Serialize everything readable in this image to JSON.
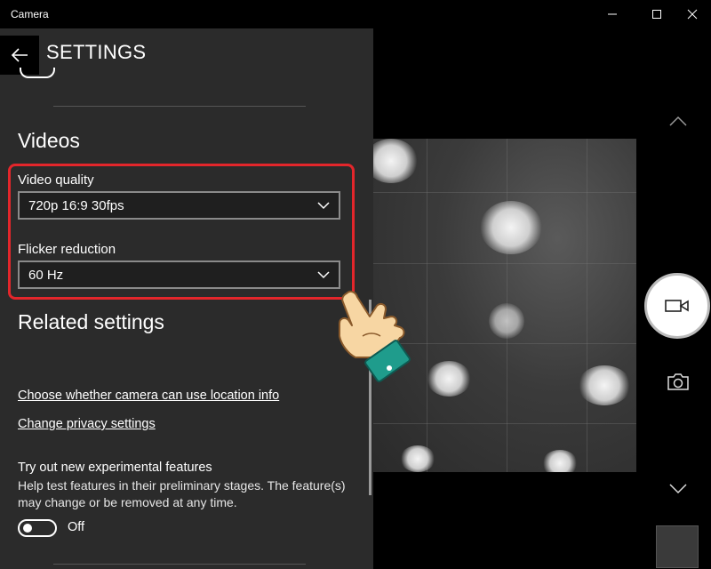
{
  "window": {
    "title": "Camera",
    "controls": [
      "minimize-icon",
      "maximize-icon",
      "close-icon"
    ]
  },
  "settings": {
    "title": "SETTINGS",
    "videos": {
      "heading": "Videos",
      "video_quality": {
        "label": "Video quality",
        "value": "720p 16:9 30fps"
      },
      "flicker_reduction": {
        "label": "Flicker reduction",
        "value": "60 Hz"
      }
    },
    "related": {
      "heading": "Related settings",
      "location_link": "Choose whether camera can use location info",
      "privacy_link": "Change privacy settings"
    },
    "experimental": {
      "title": "Try out new experimental features",
      "description": "Help test features in their preliminary stages. The feature(s) may change or be removed at any time.",
      "toggle_state": "Off"
    }
  },
  "camera": {
    "icons": [
      "chevron-up-icon",
      "video-camera-icon",
      "photo-camera-icon",
      "chevron-down-icon"
    ]
  },
  "colors": {
    "pane_bg": "#2b2b2b",
    "highlight": "#e3262b",
    "hand_cuff": "#1f9c8c"
  }
}
